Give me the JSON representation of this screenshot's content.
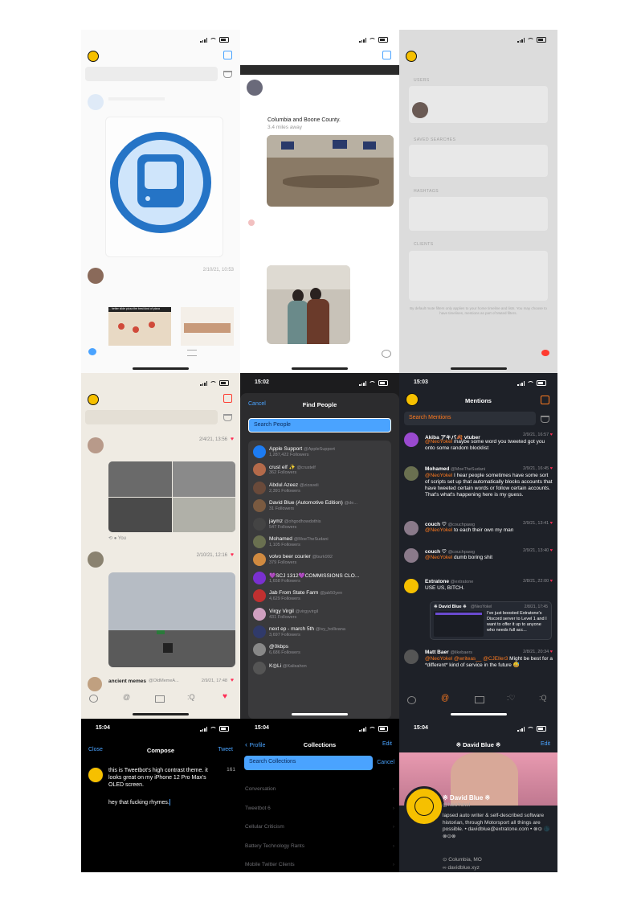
{
  "p1": {
    "timestamp": "2/10/21, 10:53",
    "caption": "... better slide pizza the best kind of pizza"
  },
  "p2": {
    "location": "Columbia and Boone County.",
    "distance": "3.4 miles away"
  },
  "p3": {
    "sections": [
      "USERS",
      "SAVED SEARCHES",
      "HASHTAGS",
      "CLIENTS"
    ],
    "footer": "By default mute filters only applies to your home timeline and lists. You may choose to have timelines, mentions as part of Muted filters."
  },
  "p4": {
    "t1": "2/4/21, 13:56",
    "t2": "2/10/21, 12:16",
    "you": "You",
    "last_name": "ancient memes",
    "last_handle": "@OldMemeA...",
    "last_time": "2/9/21, 17:48"
  },
  "p5": {
    "time": "15:02",
    "cancel": "Cancel",
    "title": "Find People",
    "placeholder": "Search People",
    "people": [
      {
        "name": "Apple Support",
        "handle": "@AppleSupport",
        "followers": "1,287,422 Followers",
        "color": "#1d7cf2"
      },
      {
        "name": "crust elf ✨",
        "handle": "@crustelf",
        "followers": "362 Followers",
        "color": "#b46a4a"
      },
      {
        "name": "Abdul Azeez",
        "handle": "@zizaveli",
        "followers": "2,391 Followers",
        "color": "#6a4a3a"
      },
      {
        "name": "David Blue (Automotive Edition)",
        "handle": "@de...",
        "followers": "31 Followers",
        "color": "#7a5a40"
      },
      {
        "name": "jaymz",
        "handle": "@ohgodhowdothis",
        "followers": "547 Followers",
        "color": "#444"
      },
      {
        "name": "Mohamed",
        "handle": "@MoeTheSudani",
        "followers": "1,105 Followers",
        "color": "#6a7050"
      },
      {
        "name": "volvo beer courier",
        "handle": "@burk992",
        "followers": "379 Followers",
        "color": "#d08a40"
      },
      {
        "name": "💜SCJ 1312💜COMMISSIONS CLO...",
        "handle": "",
        "followers": "1,658 Followers",
        "color": "#7a30d0"
      },
      {
        "name": "Jab From State Farm",
        "handle": "@jab50yen",
        "followers": "4,629 Followers",
        "color": "#c03030"
      },
      {
        "name": "Virgy Virgil",
        "handle": "@virgyvirgil",
        "followers": "431 Followers",
        "color": "#d0a0c0"
      },
      {
        "name": "next ep - march 5th",
        "handle": "@ivy_hollivana",
        "followers": "3,697 Followers",
        "color": "#303a6a"
      },
      {
        "name": "@0kbps",
        "handle": "",
        "followers": "6,686 Followers",
        "color": "#888"
      },
      {
        "name": "K◎Li",
        "handle": "@Kalisahon",
        "followers": "",
        "color": "#555"
      }
    ]
  },
  "p6": {
    "time": "15:03",
    "title": "Mentions",
    "placeholder": "Search Mentions",
    "mentions": [
      {
        "name": "Akiba アキバ🍂 vtuber",
        "handle": "",
        "time": "2/9/21, 16:57",
        "mention": "@NeoYokel",
        "text": " maybe some word you tweeted got you onto some random blocklist",
        "color": "#9a4ad0"
      },
      {
        "name": "Mohamed",
        "handle": "@MoeTheSudani",
        "time": "2/9/21, 16:45",
        "mention": "@NeoYokel",
        "text": " I hear people sometimes have some sort of scripts set up that automatically blocks accounts that have tweeted certain words or follow certain accounts. That's what's happening here is my guess.",
        "color": "#6a7050"
      },
      {
        "name": "couch ♡",
        "handle": "@couchpawg",
        "time": "2/9/21, 13:41",
        "mention": "@NeoYokel",
        "text": " to each their own my man",
        "color": "#8a7a8a"
      },
      {
        "name": "couch ♡",
        "handle": "@couchpawg",
        "time": "2/9/21, 13:40",
        "mention": "@NeoYokel",
        "text": " dumb boring shit",
        "color": "#8a7a8a"
      },
      {
        "name": "Extratone",
        "handle": "@extratone",
        "time": "2/8/21, 22:00",
        "mention": "",
        "text": "USE US, BITCH.",
        "color": "#f6c000"
      },
      {
        "name": "Matt Baer",
        "handle": "@likebaers",
        "time": "2/8/21, 20:34",
        "mention": "@NeoYokel @writeas__ @CJEller3",
        "text": " Might be best for a *different* kind of service in the future 😅",
        "color": "#555"
      }
    ],
    "quote": {
      "name": "※ David Blue ※",
      "handle": "@NeoYokel",
      "time": "2/8/21, 17:45",
      "text": "I've just boosted Extratone's Discord server to Level 1 and I want to offer it up to anyone who needs full acc..."
    }
  },
  "p7": {
    "time": "15:04",
    "close": "Close",
    "title": "Compose",
    "tweet": "Tweet",
    "count": "161",
    "line1": "this is Tweetbot's high contrast theme. it looks great on my iPhone 12 Pro Max's OLED screen.",
    "line2": "hey that fucking rhymes."
  },
  "p8": {
    "time": "15:04",
    "back": "Profile",
    "title": "Collections",
    "edit": "Edit",
    "placeholder": "Search Collections",
    "cancel": "Cancel",
    "items": [
      "Conversation",
      "Tweetbot 6",
      "Cellular Criticism",
      "Battery Technology Rants",
      "Mobile Twitter Clients"
    ]
  },
  "p9": {
    "time": "15:04",
    "title": "※ David Blue ※",
    "edit": "Edit",
    "name": "※ David Blue ※",
    "handle": "@NeoYokel",
    "bio": "lapsed auto writer & self-described software historian, through Motorsport all things are possible. • davidblue@extratone.com • ⊗⊙ 🌑 ⊗⊙⊗",
    "location": "Columbia, MO",
    "url": "davidblue.xyz"
  }
}
